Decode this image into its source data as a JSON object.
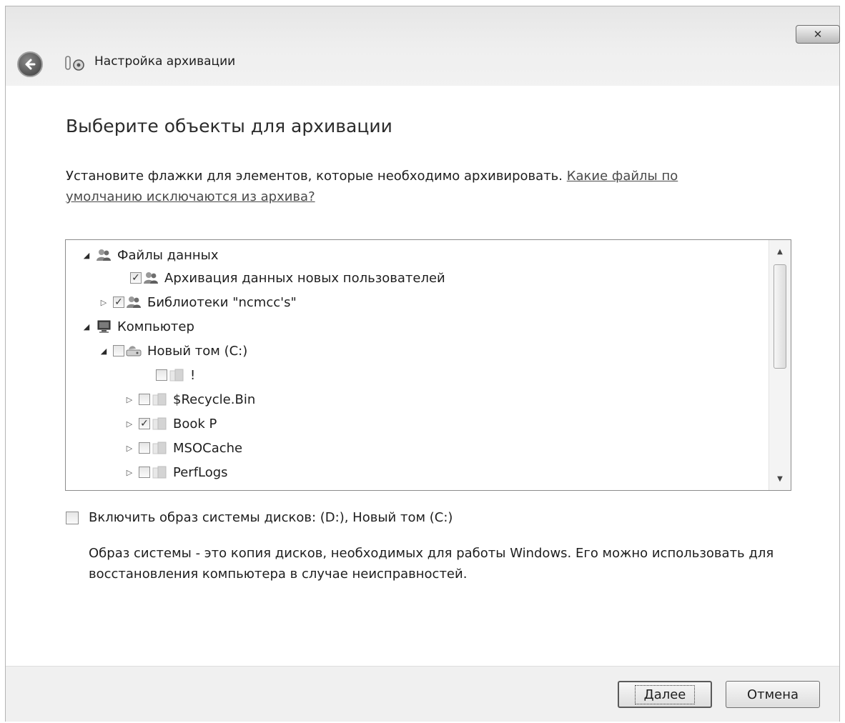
{
  "window": {
    "title": "Настройка архивации",
    "close_glyph": "✕"
  },
  "page": {
    "heading": "Выберите объекты для архивации",
    "instructions": "Установите флажки для элементов, которые необходимо архивировать.",
    "link_text": "Какие файлы по умолчанию исключаются из архива?"
  },
  "tree": {
    "rows": [
      {
        "label": "Файлы данных",
        "expander": "◢",
        "checkbox": "none",
        "icon": "users-icon"
      },
      {
        "label": "Архивация данных новых пользователей",
        "expander": "",
        "checkbox": "checked",
        "icon": "users-icon"
      },
      {
        "label": "Библиотеки \"ncmcc's\"",
        "expander": "▷",
        "checkbox": "checked",
        "icon": "users-icon"
      },
      {
        "label": "Компьютер",
        "expander": "◢",
        "checkbox": "none",
        "icon": "computer-icon"
      },
      {
        "label": "Новый том (C:)",
        "expander": "◢",
        "checkbox": "unchecked",
        "icon": "drive-icon"
      },
      {
        "label": "!",
        "expander": "",
        "checkbox": "unchecked",
        "icon": "folder-icon"
      },
      {
        "label": "$Recycle.Bin",
        "expander": "▷",
        "checkbox": "unchecked",
        "icon": "folder-icon"
      },
      {
        "label": "Book P",
        "expander": "▷",
        "checkbox": "checked",
        "icon": "folder-icon"
      },
      {
        "label": "MSOCache",
        "expander": "▷",
        "checkbox": "unchecked",
        "icon": "folder-icon"
      },
      {
        "label": "PerfLogs",
        "expander": "▷",
        "checkbox": "unchecked",
        "icon": "folder-icon"
      }
    ]
  },
  "system_image": {
    "label": "Включить образ системы дисков: (D:), Новый том (C:)",
    "checked": false,
    "description": "Образ системы - это копия дисков, необходимых для работы Windows. Его можно использовать для восстановления компьютера в случае неисправностей."
  },
  "buttons": {
    "next": "Далее",
    "cancel": "Отмена"
  }
}
